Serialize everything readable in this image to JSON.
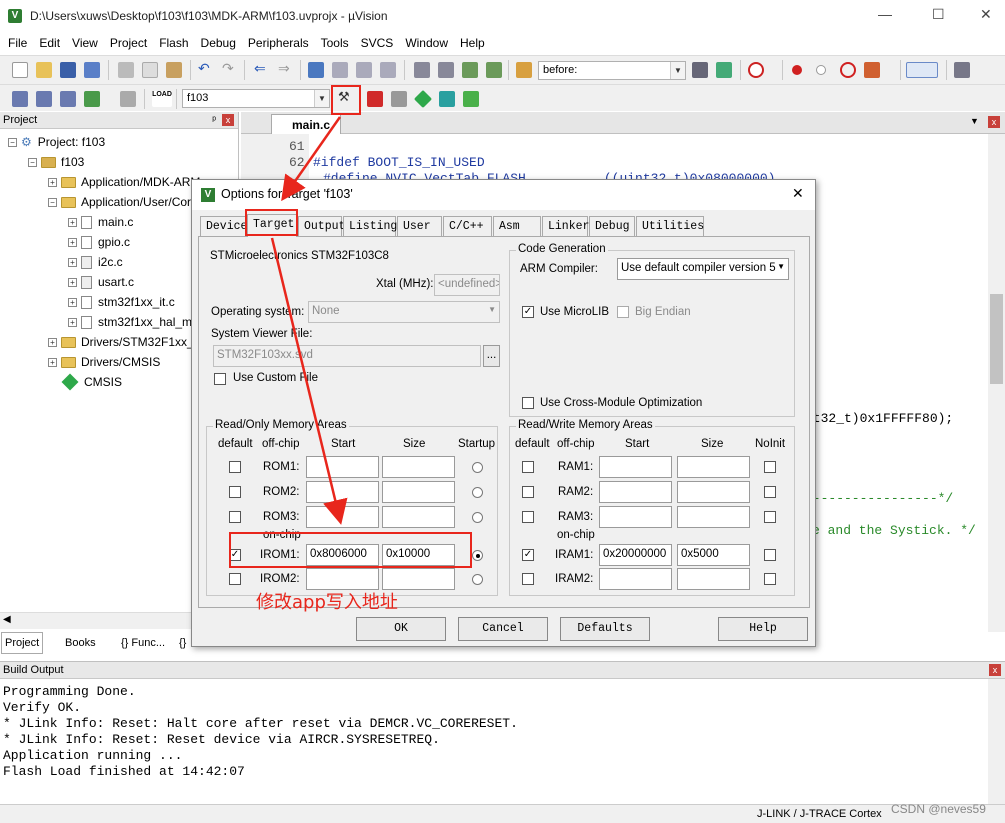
{
  "window": {
    "title": "D:\\Users\\xuws\\Desktop\\f103\\f103\\MDK-ARM\\f103.uvprojx - µVision",
    "minimize": "—",
    "maximize": "☐",
    "close": "✕"
  },
  "menu": [
    "File",
    "Edit",
    "View",
    "Project",
    "Flash",
    "Debug",
    "Peripherals",
    "Tools",
    "SVCS",
    "Window",
    "Help"
  ],
  "toolbar": {
    "find_value": "before:",
    "target_value": "f103",
    "load_label": "LOAD"
  },
  "project_panel": {
    "title": "Project",
    "pin": "ᵖ",
    "close": "x",
    "tree": [
      {
        "label": "Project: f103",
        "exp": "−",
        "kind": "proj"
      },
      {
        "label": "f103",
        "exp": "−",
        "kind": "target"
      },
      {
        "label": "Application/MDK-ARM",
        "exp": "+",
        "kind": "folder"
      },
      {
        "label": "Application/User/Core",
        "exp": "−",
        "kind": "folder"
      },
      {
        "label": "main.c",
        "exp": "+",
        "kind": "file"
      },
      {
        "label": "gpio.c",
        "exp": "+",
        "kind": "file"
      },
      {
        "label": "i2c.c",
        "exp": "+",
        "kind": "file"
      },
      {
        "label": "usart.c",
        "exp": "+",
        "kind": "file"
      },
      {
        "label": "stm32f1xx_it.c",
        "exp": "+",
        "kind": "file"
      },
      {
        "label": "stm32f1xx_hal_msp.c",
        "exp": "+",
        "kind": "file"
      },
      {
        "label": "Drivers/STM32F1xx_HAL_Driver",
        "exp": "+",
        "kind": "folder"
      },
      {
        "label": "Drivers/CMSIS",
        "exp": "+",
        "kind": "folder"
      },
      {
        "label": "CMSIS",
        "exp": "",
        "kind": "cmsis"
      }
    ],
    "bottom_tabs": [
      "Project",
      "Books",
      "{} Func...",
      "{}"
    ]
  },
  "editor": {
    "tab": "main.c",
    "lines": [
      {
        "n": "61",
        "text": ""
      },
      {
        "n": "62",
        "text": "#ifdef BOOT_IS_IN_USED"
      },
      {
        "n": "",
        "text": "#define NVIC_VectTab_FLASH          ((uint32_t)0x08000000)"
      }
    ],
    "visible_fragments": [
      "nt32_t)0x1FFFFF80);",
      "-----------------*/",
      "e and the Systick. */"
    ]
  },
  "build_output": {
    "title": "Build Output",
    "lines": [
      "Programming Done.",
      "Verify OK.",
      "* JLink Info: Reset: Halt core after reset via DEMCR.VC_CORERESET.",
      "* JLink Info: Reset: Reset device via AIRCR.SYSRESETREQ.",
      "Application running ...",
      "Flash Load finished at 14:42:07"
    ]
  },
  "statusbar": {
    "debugger": "J-LINK / J-TRACE Cortex",
    "watermark": "CSDN @neves59"
  },
  "dialog": {
    "title": "Options for Target 'f103'",
    "close": "✕",
    "tabs": [
      "Device",
      "Target",
      "Output",
      "Listing",
      "User",
      "C/C++",
      "Asm",
      "Linker",
      "Debug",
      "Utilities"
    ],
    "active_tab": "Target",
    "device_name": "STMicroelectronics STM32F103C8",
    "xtal_label": "Xtal (MHz):",
    "xtal_value": "<undefined>",
    "os_label": "Operating system:",
    "os_value": "None",
    "svf_label": "System Viewer File:",
    "svf_value": "STM32F103xx.svd",
    "svf_browse": "...",
    "custom_file_label": "Use Custom File",
    "codegen": {
      "title": "Code Generation",
      "compiler_label": "ARM Compiler:",
      "compiler_value": "Use default compiler version 5",
      "microlib_label": "Use MicroLIB",
      "bigendian_label": "Big Endian",
      "cross_label": "Use Cross-Module Optimization"
    },
    "rom": {
      "title": "Read/Only Memory Areas",
      "headers": [
        "default",
        "off-chip",
        "Start",
        "Size",
        "Startup"
      ],
      "onchip": "on-chip",
      "rows": [
        {
          "name": "ROM1:",
          "start": "",
          "size": "",
          "checked": false,
          "startup": false
        },
        {
          "name": "ROM2:",
          "start": "",
          "size": "",
          "checked": false,
          "startup": false
        },
        {
          "name": "ROM3:",
          "start": "",
          "size": "",
          "checked": false,
          "startup": false
        },
        {
          "name": "IROM1:",
          "start": "0x8006000",
          "size": "0x10000",
          "checked": true,
          "startup": true
        },
        {
          "name": "IROM2:",
          "start": "",
          "size": "",
          "checked": false,
          "startup": false
        }
      ]
    },
    "ram": {
      "title": "Read/Write Memory Areas",
      "headers": [
        "default",
        "off-chip",
        "Start",
        "Size",
        "NoInit"
      ],
      "onchip": "on-chip",
      "rows": [
        {
          "name": "RAM1:",
          "start": "",
          "size": "",
          "checked": false
        },
        {
          "name": "RAM2:",
          "start": "",
          "size": "",
          "checked": false
        },
        {
          "name": "RAM3:",
          "start": "",
          "size": "",
          "checked": false
        },
        {
          "name": "IRAM1:",
          "start": "0x20000000",
          "size": "0x5000",
          "checked": true
        },
        {
          "name": "IRAM2:",
          "start": "",
          "size": "",
          "checked": false
        }
      ]
    },
    "buttons": {
      "ok": "OK",
      "cancel": "Cancel",
      "defaults": "Defaults",
      "help": "Help"
    }
  },
  "annotation": {
    "text": "修改app写入地址",
    "color": "#e8261c"
  }
}
